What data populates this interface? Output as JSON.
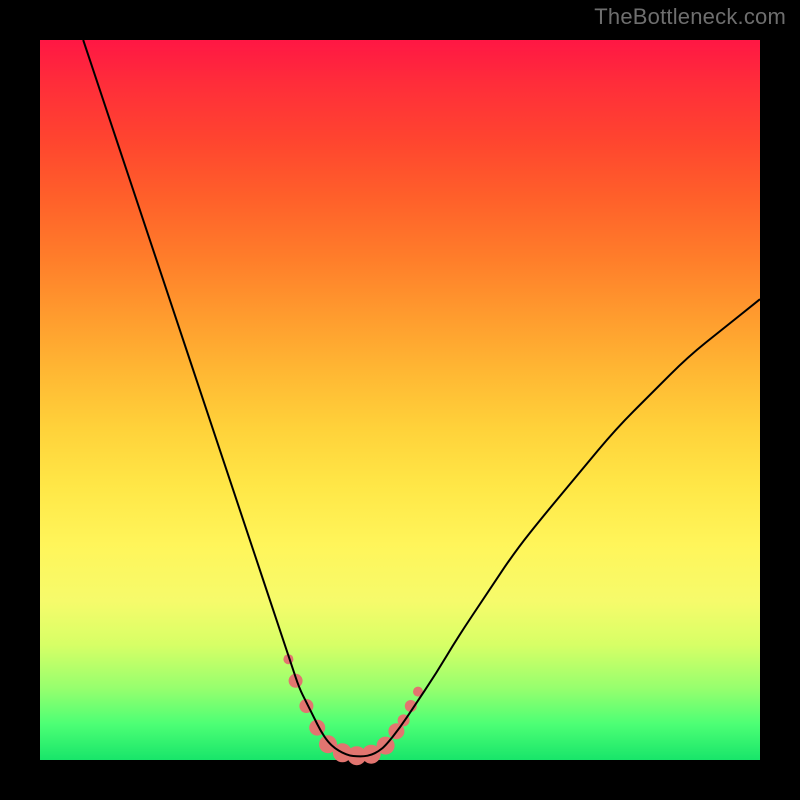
{
  "watermark": "TheBottleneck.com",
  "chart_data": {
    "type": "line",
    "title": "",
    "xlabel": "",
    "ylabel": "",
    "xlim": [
      0,
      100
    ],
    "ylim": [
      0,
      100
    ],
    "series": [
      {
        "name": "curve",
        "x": [
          6,
          8,
          10,
          12,
          14,
          16,
          18,
          20,
          22,
          24,
          26,
          28,
          30,
          32,
          34,
          35,
          36,
          37,
          38,
          39,
          40,
          41,
          42,
          43,
          44,
          45,
          46,
          47,
          48,
          50,
          52,
          55,
          58,
          62,
          66,
          70,
          75,
          80,
          85,
          90,
          95,
          100
        ],
        "y": [
          100,
          94,
          88,
          82,
          76,
          70,
          64,
          58,
          52,
          46,
          40,
          34,
          28,
          22,
          16,
          13,
          10,
          8,
          6,
          4,
          2.5,
          1.6,
          1.0,
          0.6,
          0.5,
          0.5,
          0.7,
          1.2,
          2.0,
          4.5,
          7.5,
          12,
          17,
          23,
          29,
          34,
          40,
          46,
          51,
          56,
          60,
          64
        ]
      }
    ],
    "markers": {
      "name": "highlighted-points",
      "color": "#e27570",
      "points": [
        {
          "x": 34.5,
          "y": 14,
          "r": 5
        },
        {
          "x": 35.5,
          "y": 11,
          "r": 7
        },
        {
          "x": 37.0,
          "y": 7.5,
          "r": 7
        },
        {
          "x": 38.5,
          "y": 4.5,
          "r": 8
        },
        {
          "x": 40.0,
          "y": 2.2,
          "r": 9
        },
        {
          "x": 42.0,
          "y": 1.0,
          "r": 9.5
        },
        {
          "x": 44.0,
          "y": 0.6,
          "r": 9.5
        },
        {
          "x": 46.0,
          "y": 0.8,
          "r": 9.5
        },
        {
          "x": 48.0,
          "y": 2.0,
          "r": 9
        },
        {
          "x": 49.5,
          "y": 4.0,
          "r": 8
        },
        {
          "x": 50.5,
          "y": 5.5,
          "r": 6
        },
        {
          "x": 51.5,
          "y": 7.5,
          "r": 6
        },
        {
          "x": 52.5,
          "y": 9.5,
          "r": 5
        }
      ]
    }
  }
}
